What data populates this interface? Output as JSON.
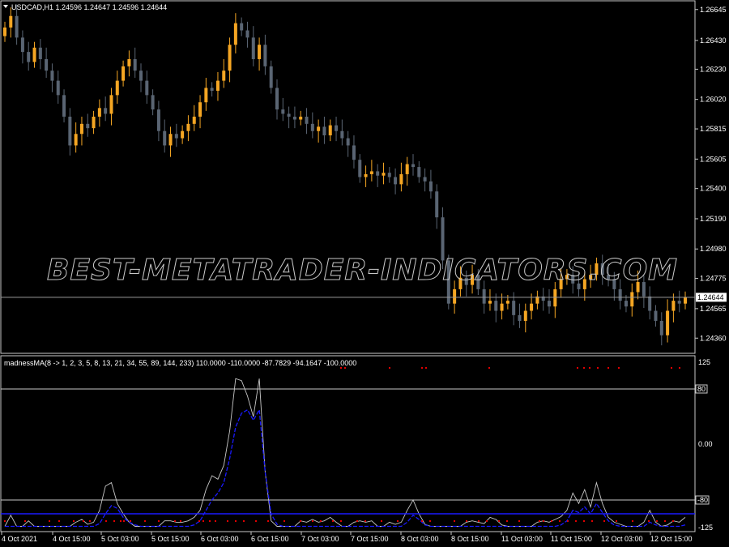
{
  "main_chart": {
    "title": "USDCAD,H1  1.24596 1.24647 1.24596 1.24644",
    "price_labels": [
      "1.26645",
      "1.26430",
      "1.26230",
      "1.26020",
      "1.25815",
      "1.25605",
      "1.25400",
      "1.25190",
      "1.24980",
      "1.24775",
      "1.24565",
      "1.24360"
    ],
    "current_price": "1.24644",
    "watermark": "BEST-METATRADER-INDICATORS.COM"
  },
  "indicator": {
    "title": "madnessMA(8 -> 1, 2, 3, 5, 8, 13, 21, 34, 55, 89, 144, 233) 110.0000 -110.0000 -87.7829 -94.1647 -100.0000",
    "level_labels": [
      "125",
      "80",
      "0.00",
      "-80",
      "-125"
    ]
  },
  "time_axis": [
    "4 Oct 2021",
    "4 Oct 15:00",
    "5 Oct 03:00",
    "5 Oct 15:00",
    "6 Oct 03:00",
    "6 Oct 15:00",
    "7 Oct 03:00",
    "7 Oct 15:00",
    "8 Oct 03:00",
    "8 Oct 15:00",
    "11 Oct 03:00",
    "11 Oct 15:00",
    "12 Oct 03:00",
    "12 Oct 15:00"
  ],
  "colors": {
    "bull": "#f5a623",
    "bear": "#5a6573",
    "grid": "#c8c8c8",
    "fast_line": "#c8c8c8",
    "slow_line": "#1a1aff",
    "dots": "#e00000",
    "current_price_line": "#9a9a9a"
  },
  "chart_data": [
    {
      "type": "candlestick",
      "title": "USDCAD,H1",
      "ylim": [
        1.2426,
        1.267
      ],
      "y_ticks": [
        1.26645,
        1.2643,
        1.2623,
        1.2602,
        1.25815,
        1.25605,
        1.254,
        1.2519,
        1.2498,
        1.24775,
        1.24565,
        1.2436
      ],
      "x_tick_labels": [
        "4 Oct 2021",
        "4 Oct 15:00",
        "5 Oct 03:00",
        "5 Oct 15:00",
        "6 Oct 03:00",
        "6 Oct 15:00",
        "7 Oct 03:00",
        "7 Oct 15:00",
        "8 Oct 03:00",
        "8 Oct 15:00",
        "11 Oct 03:00",
        "11 Oct 15:00",
        "12 Oct 03:00",
        "12 Oct 15:00"
      ],
      "current_price": 1.24644,
      "closes": [
        1.2652,
        1.266,
        1.2645,
        1.2635,
        1.2628,
        1.2638,
        1.263,
        1.2622,
        1.2615,
        1.2605,
        1.259,
        1.257,
        1.2578,
        1.2585,
        1.2582,
        1.259,
        1.2596,
        1.2592,
        1.2605,
        1.2615,
        1.2625,
        1.263,
        1.2622,
        1.2615,
        1.2605,
        1.2595,
        1.258,
        1.257,
        1.2578,
        1.2575,
        1.258,
        1.2585,
        1.259,
        1.26,
        1.261,
        1.2608,
        1.2615,
        1.2622,
        1.264,
        1.2655,
        1.265,
        1.2645,
        1.263,
        1.264,
        1.2625,
        1.261,
        1.2595,
        1.2592,
        1.259,
        1.2588,
        1.259,
        1.2585,
        1.258,
        1.2583,
        1.2577,
        1.2584,
        1.258,
        1.2575,
        1.257,
        1.256,
        1.2548,
        1.255,
        1.2552,
        1.2549,
        1.2551,
        1.2548,
        1.2543,
        1.255,
        1.2557,
        1.2555,
        1.2548,
        1.2545,
        1.2538,
        1.252,
        1.249,
        1.246,
        1.247,
        1.2478,
        1.2473,
        1.248,
        1.247,
        1.246,
        1.2462,
        1.2455,
        1.246,
        1.2462,
        1.2452,
        1.2448,
        1.2455,
        1.246,
        1.2465,
        1.2462,
        1.2458,
        1.247,
        1.2477,
        1.248,
        1.2474,
        1.247,
        1.2477,
        1.248,
        1.2488,
        1.248,
        1.2477,
        1.247,
        1.2462,
        1.2458,
        1.2468,
        1.2475,
        1.2465,
        1.2455,
        1.2448,
        1.2438,
        1.2455,
        1.2462,
        1.246,
        1.24644
      ],
      "fast_line": [
        -118,
        -102,
        -118,
        -118,
        -110,
        -118,
        -118,
        -118,
        -118,
        -118,
        -118,
        -118,
        -112,
        -108,
        -115,
        -112,
        -95,
        -60,
        -55,
        -85,
        -100,
        -112,
        -118,
        -118,
        -118,
        -118,
        -118,
        -110,
        -110,
        -112,
        -112,
        -110,
        -105,
        -95,
        -65,
        -45,
        -50,
        -30,
        20,
        95,
        92,
        70,
        40,
        95,
        -40,
        -110,
        -118,
        -118,
        -118,
        -118,
        -110,
        -112,
        -108,
        -112,
        -110,
        -105,
        -112,
        -118,
        -118,
        -112,
        -110,
        -112,
        -110,
        -118,
        -118,
        -112,
        -115,
        -112,
        -95,
        -80,
        -100,
        -115,
        -118,
        -118,
        -118,
        -118,
        -118,
        -118,
        -112,
        -110,
        -112,
        -114,
        -105,
        -108,
        -116,
        -118,
        -118,
        -118,
        -118,
        -118,
        -112,
        -110,
        -112,
        -108,
        -104,
        -95,
        -70,
        -85,
        -65,
        -90,
        -55,
        -85,
        -105,
        -112,
        -115,
        -118,
        -118,
        -118,
        -112,
        -95,
        -112,
        -118,
        -116,
        -110,
        -112,
        -105
      ],
      "slow_line": [
        -118,
        -118,
        -118,
        -118,
        -118,
        -118,
        -118,
        -118,
        -118,
        -118,
        -118,
        -118,
        -118,
        -118,
        -118,
        -118,
        -114,
        -100,
        -88,
        -92,
        -105,
        -112,
        -116,
        -118,
        -118,
        -118,
        -118,
        -118,
        -118,
        -118,
        -118,
        -118,
        -116,
        -110,
        -95,
        -80,
        -70,
        -55,
        -20,
        25,
        45,
        50,
        35,
        50,
        -40,
        -100,
        -115,
        -118,
        -118,
        -118,
        -118,
        -118,
        -118,
        -118,
        -118,
        -118,
        -118,
        -118,
        -118,
        -118,
        -118,
        -118,
        -118,
        -118,
        -118,
        -118,
        -118,
        -118,
        -112,
        -102,
        -108,
        -116,
        -118,
        -118,
        -118,
        -118,
        -118,
        -118,
        -118,
        -118,
        -118,
        -118,
        -118,
        -118,
        -118,
        -118,
        -118,
        -118,
        -118,
        -118,
        -118,
        -118,
        -118,
        -118,
        -116,
        -110,
        -95,
        -98,
        -90,
        -100,
        -85,
        -98,
        -110,
        -116,
        -118,
        -118,
        -118,
        -118,
        -118,
        -112,
        -116,
        -118,
        -118,
        -118,
        -118,
        -116
      ]
    }
  ]
}
